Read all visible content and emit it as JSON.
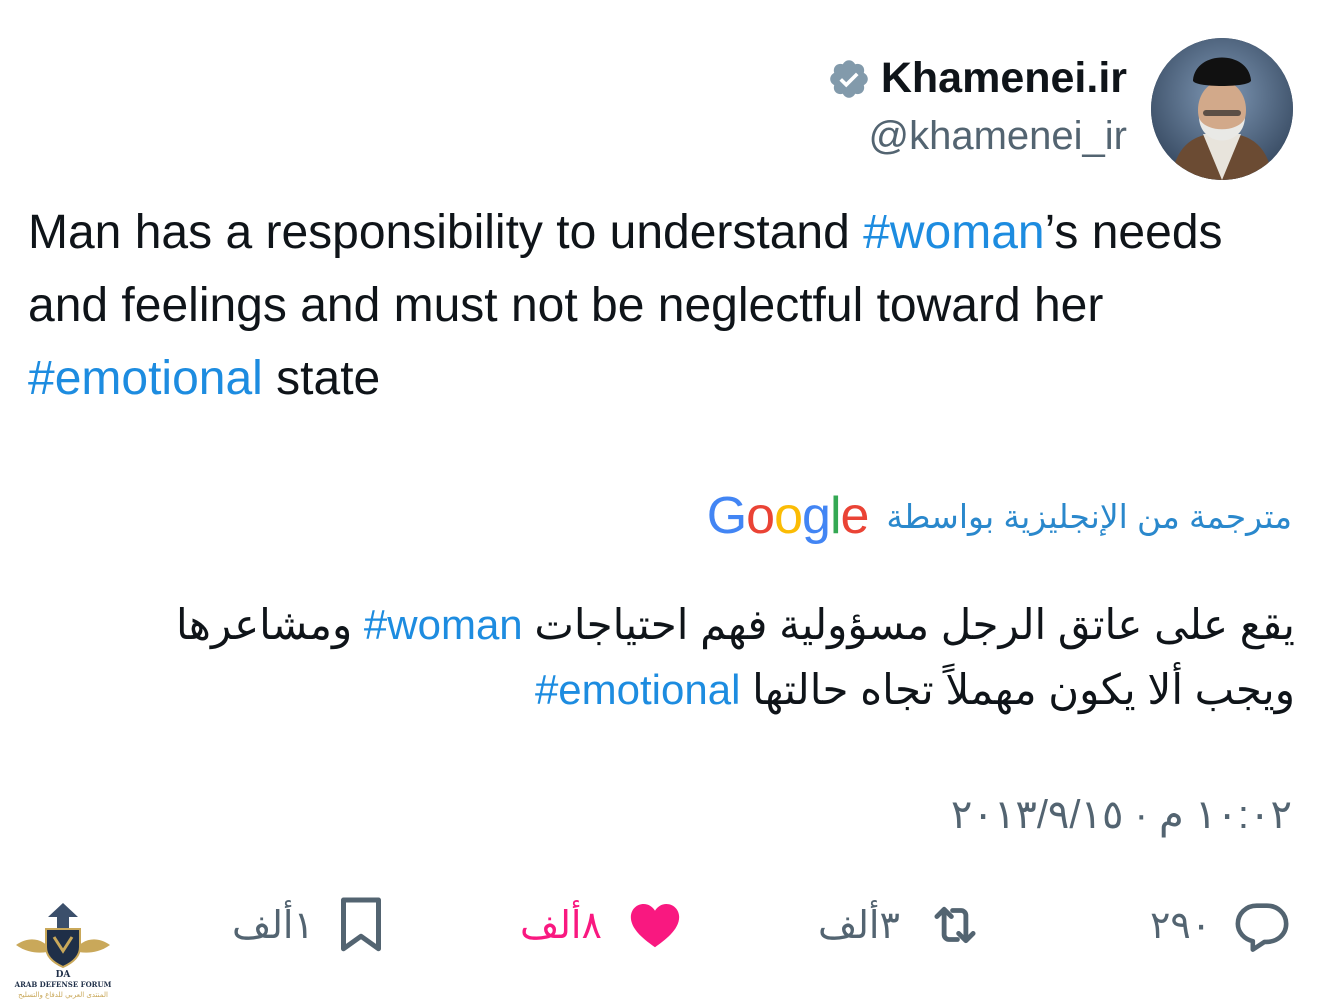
{
  "tweet": {
    "display_name": "Khamenei.ir",
    "handle": "@khamenei_ir",
    "text_parts": {
      "p1": "Man has a responsibility to understand ",
      "tag1": "#woman",
      "p2": "’s needs and feelings and must not be neglectful toward her ",
      "tag2": "#emotional",
      "p3": " state"
    },
    "translated_label": "مترجمة من الإنجليزية بواسطة",
    "google_logo": "Google",
    "translation_parts": {
      "a1": "يقع على عاتق الرجل مسؤولية فهم احتياجات ",
      "tag1": "#woman",
      "a2": " ومشاعرها ويجب ألا يكون مهملاً تجاه حالتها ",
      "tag2": "#emotional"
    },
    "timestamp": "١٠:٠٢ م · ٢٠١٣/٩/١٥"
  },
  "actions": {
    "replies": "٢٩٠",
    "retweets": "٣ألف",
    "likes": "٨ألف",
    "bookmarks": "١ألف"
  },
  "watermark": {
    "title": "ARAB DEFENSE FORUM",
    "subtitle": "المنتدى العربي للدفاع والتسليح",
    "mark": "DA"
  },
  "colors": {
    "hashtag": "#1d8ce0",
    "like": "#f91880",
    "secondary": "#536471",
    "verified": "#829aab"
  },
  "icons": [
    "verified-badge-icon",
    "reply-icon",
    "retweet-icon",
    "heart-icon",
    "bookmark-icon"
  ]
}
